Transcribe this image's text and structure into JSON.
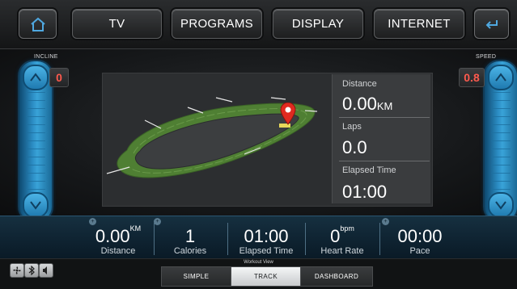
{
  "top_nav": {
    "tabs": [
      {
        "label": "TV"
      },
      {
        "label": "PROGRAMS"
      },
      {
        "label": "DISPLAY"
      },
      {
        "label": "INTERNET"
      }
    ],
    "home_icon": "home-icon",
    "back_icon": "back-arrow-icon"
  },
  "incline": {
    "label": "INCLINE",
    "value": "0"
  },
  "speed": {
    "label": "SPEED",
    "value": "0.8"
  },
  "track_info": {
    "distance_label": "Distance",
    "distance_value": "0.00",
    "distance_unit": "KM",
    "laps_label": "Laps",
    "laps_value": "0.0",
    "elapsed_label": "Elapsed Time",
    "elapsed_value": "01:00"
  },
  "stats": [
    {
      "value": "0.00",
      "unit": "KM",
      "label": "Distance"
    },
    {
      "value": "1",
      "unit": "",
      "label": "Calories"
    },
    {
      "value": "01:00",
      "unit": "",
      "label": "Elapsed Time"
    },
    {
      "value": "0",
      "unit": "bpm",
      "label": "Heart Rate"
    },
    {
      "value": "00:00",
      "unit": "",
      "label": "Pace"
    }
  ],
  "workout_view": {
    "caption": "Workout View",
    "tabs": [
      {
        "label": "SIMPLE"
      },
      {
        "label": "TRACK"
      },
      {
        "label": "DASHBOARD"
      }
    ],
    "active": "TRACK"
  },
  "colors": {
    "accent_blue": "#2b8bc2",
    "badge_red": "#ff5a4e",
    "track_green": "#5a8a3a",
    "pin_red": "#e02a20"
  }
}
